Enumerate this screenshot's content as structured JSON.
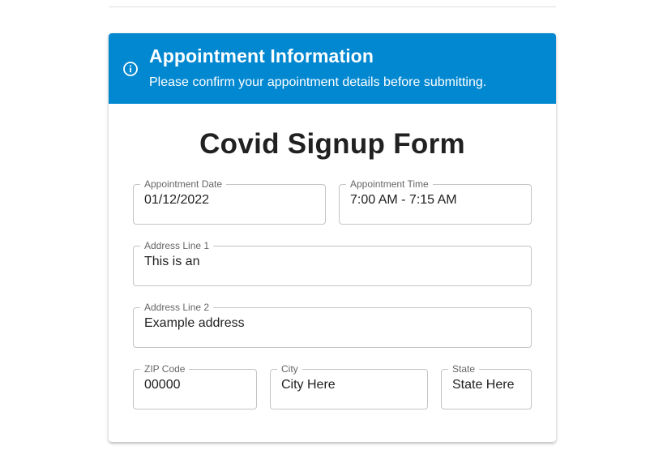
{
  "banner": {
    "icon": "info-icon",
    "title": "Appointment Information",
    "text": "Please confirm your appointment details before submitting.",
    "color": "#0288d1"
  },
  "form": {
    "title": "Covid Signup Form",
    "fields": {
      "appointment_date": {
        "label": "Appointment Date",
        "value": "01/12/2022"
      },
      "appointment_time": {
        "label": "Appointment Time",
        "value": "7:00 AM - 7:15 AM"
      },
      "address_line_1": {
        "label": "Address Line 1",
        "value": "This is an"
      },
      "address_line_2": {
        "label": "Address Line 2",
        "value": "Example address"
      },
      "zip_code": {
        "label": "ZIP Code",
        "value": "00000"
      },
      "city": {
        "label": "City",
        "value": "City Here"
      },
      "state": {
        "label": "State",
        "value": "State Here"
      }
    }
  }
}
